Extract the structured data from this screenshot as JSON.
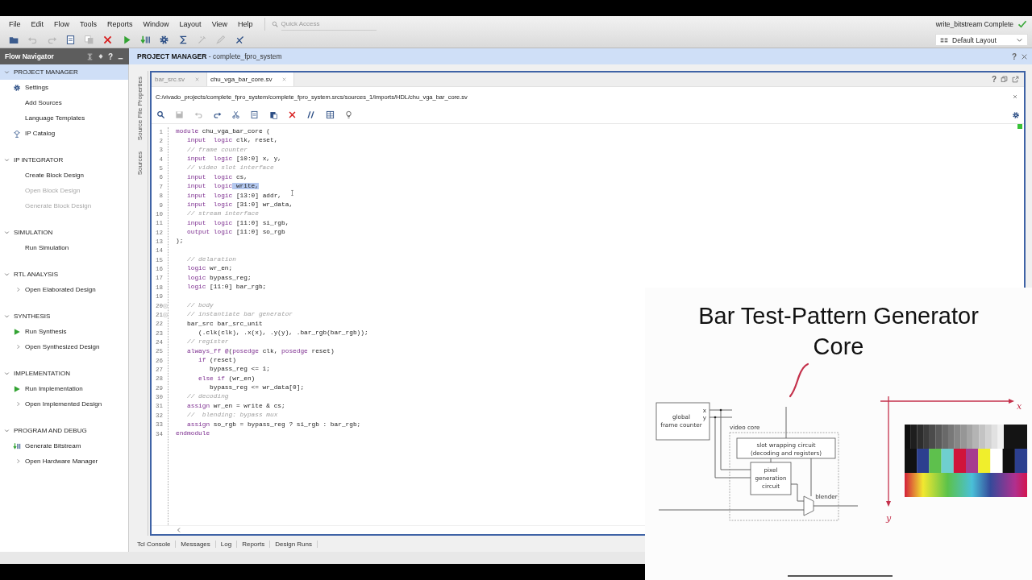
{
  "menu": [
    "File",
    "Edit",
    "Flow",
    "Tools",
    "Reports",
    "Window",
    "Layout",
    "View",
    "Help"
  ],
  "quick_access": {
    "placeholder": "Quick Access"
  },
  "toolbar_buttons": [
    {
      "disabled": false
    },
    {
      "disabled": true
    },
    {
      "disabled": true
    },
    {
      "disabled": false
    },
    {
      "disabled": true
    },
    {
      "disabled": false
    },
    {
      "disabled": false
    },
    {
      "disabled": false
    },
    {
      "disabled": false
    },
    {
      "disabled": false
    },
    {
      "disabled": true
    },
    {
      "disabled": true
    },
    {
      "disabled": false
    }
  ],
  "status": {
    "text": "write_bitstream Complete",
    "complete": true
  },
  "layout_select": {
    "value": "Default Layout"
  },
  "flow_navigator": {
    "title": "Flow Navigator",
    "help": "?",
    "sections": [
      {
        "title": "PROJECT MANAGER",
        "expanded": true,
        "selected": true,
        "items": [
          {
            "label": "Settings",
            "kind": "settings",
            "disabled": false
          },
          {
            "label": "Add Sources",
            "kind": "plain",
            "disabled": false
          },
          {
            "label": "Language Templates",
            "kind": "plain",
            "disabled": false
          },
          {
            "label": "IP Catalog",
            "kind": "catalog",
            "disabled": false
          }
        ]
      },
      {
        "title": "IP INTEGRATOR",
        "expanded": true,
        "selected": false,
        "items": [
          {
            "label": "Create Block Design",
            "kind": "plain",
            "disabled": false
          },
          {
            "label": "Open Block Design",
            "kind": "plain",
            "disabled": true
          },
          {
            "label": "Generate Block Design",
            "kind": "plain",
            "disabled": true
          }
        ]
      },
      {
        "title": "SIMULATION",
        "expanded": true,
        "selected": false,
        "items": [
          {
            "label": "Run Simulation",
            "kind": "plain",
            "disabled": false
          }
        ]
      },
      {
        "title": "RTL ANALYSIS",
        "expanded": true,
        "selected": false,
        "items": [
          {
            "label": "Open Elaborated Design",
            "kind": "expandable",
            "disabled": false
          }
        ]
      },
      {
        "title": "SYNTHESIS",
        "expanded": true,
        "selected": false,
        "items": [
          {
            "label": "Run Synthesis",
            "kind": "run",
            "disabled": false
          },
          {
            "label": "Open Synthesized Design",
            "kind": "expandable",
            "disabled": false
          }
        ]
      },
      {
        "title": "IMPLEMENTATION",
        "expanded": true,
        "selected": false,
        "items": [
          {
            "label": "Run Implementation",
            "kind": "run",
            "disabled": false
          },
          {
            "label": "Open Implemented Design",
            "kind": "expandable",
            "disabled": false
          }
        ]
      },
      {
        "title": "PROGRAM AND DEBUG",
        "expanded": true,
        "selected": false,
        "items": [
          {
            "label": "Generate Bitstream",
            "kind": "bitstream",
            "disabled": false
          },
          {
            "label": "Open Hardware Manager",
            "kind": "expandable",
            "disabled": false
          }
        ]
      }
    ]
  },
  "project_header": {
    "title": "**PROJECT MANAGER** - complete_fpro_system",
    "help": "?"
  },
  "side_tabs": [
    {
      "label": "Source File Properties"
    },
    {
      "label": "Sources"
    }
  ],
  "editor": {
    "help": "?",
    "tabs": [
      {
        "label": "bar_src.sv",
        "selected": false
      },
      {
        "label": "chu_vga_bar_core.sv",
        "selected": true
      }
    ],
    "path": "C:/vivado_projects/complete_fpro_system/complete_fpro_system.srcs/sources_1/imports/HDL/chu_vga_bar_core.sv",
    "toolbar_buttons": [
      {
        "disabled": false
      },
      {
        "disabled": true
      },
      {
        "disabled": true
      },
      {
        "disabled": false
      },
      {
        "disabled": false
      },
      {
        "disabled": false
      },
      {
        "disabled": false
      },
      {
        "disabled": false
      },
      {
        "disabled": false
      },
      {
        "disabled": false
      },
      {
        "disabled": false
      }
    ],
    "lines": [
      {
        "number": "1",
        "fold": false,
        "tokens": [
          {
            "kind": "keyword",
            "text": "module"
          },
          {
            "kind": "plain",
            "text": " chu_vga_bar_core ("
          }
        ]
      },
      {
        "number": "2",
        "fold": false,
        "tokens": [
          {
            "kind": "keyword",
            "text": "   input"
          },
          {
            "kind": "keyword",
            "text": "  logic"
          },
          {
            "kind": "plain",
            "text": " clk, reset,"
          }
        ]
      },
      {
        "number": "3",
        "fold": false,
        "tokens": [
          {
            "kind": "comment",
            "text": "   // frame counter"
          }
        ]
      },
      {
        "number": "4",
        "fold": false,
        "tokens": [
          {
            "kind": "keyword",
            "text": "   input"
          },
          {
            "kind": "keyword",
            "text": "  logic"
          },
          {
            "kind": "plain",
            "text": " [10:0] x, y,"
          }
        ]
      },
      {
        "number": "5",
        "fold": false,
        "tokens": [
          {
            "kind": "comment",
            "text": "   // video slot interface"
          }
        ]
      },
      {
        "number": "6",
        "fold": false,
        "tokens": [
          {
            "kind": "keyword",
            "text": "   input"
          },
          {
            "kind": "keyword",
            "text": "  logic"
          },
          {
            "kind": "plain",
            "text": " cs,"
          }
        ]
      },
      {
        "number": "7",
        "fold": false,
        "tokens": [
          {
            "kind": "keyword",
            "text": "   input"
          },
          {
            "kind": "keyword",
            "text": "  logic"
          },
          {
            "kind": "selected",
            "text": " write,"
          }
        ]
      },
      {
        "number": "8",
        "fold": false,
        "tokens": [
          {
            "kind": "keyword",
            "text": "   input"
          },
          {
            "kind": "keyword",
            "text": "  logic"
          },
          {
            "kind": "plain",
            "text": " [13:0] addr,"
          }
        ]
      },
      {
        "number": "9",
        "fold": false,
        "tokens": [
          {
            "kind": "keyword",
            "text": "   input"
          },
          {
            "kind": "keyword",
            "text": "  logic"
          },
          {
            "kind": "plain",
            "text": " [31:0] wr_data,"
          }
        ]
      },
      {
        "number": "10",
        "fold": false,
        "tokens": [
          {
            "kind": "comment",
            "text": "   // stream interface"
          }
        ]
      },
      {
        "number": "11",
        "fold": false,
        "tokens": [
          {
            "kind": "keyword",
            "text": "   input"
          },
          {
            "kind": "keyword",
            "text": "  logic"
          },
          {
            "kind": "plain",
            "text": " [11:0] si_rgb,"
          }
        ]
      },
      {
        "number": "12",
        "fold": false,
        "tokens": [
          {
            "kind": "keyword",
            "text": "   output"
          },
          {
            "kind": "keyword",
            "text": " logic"
          },
          {
            "kind": "plain",
            "text": " [11:0] so_rgb"
          }
        ]
      },
      {
        "number": "13",
        "fold": false,
        "tokens": [
          {
            "kind": "plain",
            "text": ");"
          }
        ]
      },
      {
        "number": "14",
        "fold": false
      },
      {
        "number": "15",
        "fold": false,
        "tokens": [
          {
            "kind": "comment",
            "text": "   // delaration"
          }
        ]
      },
      {
        "number": "16",
        "fold": false,
        "tokens": [
          {
            "kind": "keyword",
            "text": "   logic"
          },
          {
            "kind": "plain",
            "text": " wr_en;"
          }
        ]
      },
      {
        "number": "17",
        "fold": false,
        "tokens": [
          {
            "kind": "keyword",
            "text": "   logic"
          },
          {
            "kind": "plain",
            "text": " bypass_reg;"
          }
        ]
      },
      {
        "number": "18",
        "fold": false,
        "tokens": [
          {
            "kind": "keyword",
            "text": "   logic"
          },
          {
            "kind": "plain",
            "text": " [11:0] bar_rgb;"
          }
        ]
      },
      {
        "number": "19",
        "fold": false
      },
      {
        "number": "20",
        "fold": true,
        "tokens": [
          {
            "kind": "comment",
            "text": "   // body"
          }
        ]
      },
      {
        "number": "21",
        "fold": true,
        "tokens": [
          {
            "kind": "comment",
            "text": "   // instantiate bar generator"
          }
        ]
      },
      {
        "number": "22",
        "fold": false,
        "tokens": [
          {
            "kind": "plain",
            "text": "   bar_src bar_src_unit"
          }
        ]
      },
      {
        "number": "23",
        "fold": false,
        "tokens": [
          {
            "kind": "plain",
            "text": "      (.clk(clk), .x(x), .y(y), .bar_rgb(bar_rgb));"
          }
        ]
      },
      {
        "number": "24",
        "fold": false,
        "tokens": [
          {
            "kind": "comment",
            "text": "   // register"
          }
        ]
      },
      {
        "number": "25",
        "fold": false,
        "tokens": [
          {
            "kind": "keyword",
            "text": "   always_ff"
          },
          {
            "kind": "keyword",
            "text": " @"
          },
          {
            "kind": "plain",
            "text": "("
          },
          {
            "kind": "keyword",
            "text": "posedge"
          },
          {
            "kind": "plain",
            "text": " clk, "
          },
          {
            "kind": "keyword",
            "text": "posedge"
          },
          {
            "kind": "plain",
            "text": " reset)"
          }
        ]
      },
      {
        "number": "26",
        "fold": false,
        "tokens": [
          {
            "kind": "keyword",
            "text": "      if"
          },
          {
            "kind": "plain",
            "text": " (reset)"
          }
        ]
      },
      {
        "number": "27",
        "fold": false,
        "tokens": [
          {
            "kind": "plain",
            "text": "         bypass_reg <= 1;"
          }
        ]
      },
      {
        "number": "28",
        "fold": false,
        "tokens": [
          {
            "kind": "keyword",
            "text": "      else"
          },
          {
            "kind": "keyword",
            "text": " if"
          },
          {
            "kind": "plain",
            "text": " (wr_en)"
          }
        ]
      },
      {
        "number": "29",
        "fold": false,
        "tokens": [
          {
            "kind": "plain",
            "text": "         bypass_reg <= wr_data[0];"
          }
        ]
      },
      {
        "number": "30",
        "fold": false,
        "tokens": [
          {
            "kind": "comment",
            "text": "   // decoding"
          }
        ]
      },
      {
        "number": "31",
        "fold": false,
        "tokens": [
          {
            "kind": "keyword",
            "text": "   assign"
          },
          {
            "kind": "plain",
            "text": " wr_en = write & cs;"
          }
        ]
      },
      {
        "number": "32",
        "fold": false,
        "tokens": [
          {
            "kind": "comment",
            "text": "   //  blending: bypass mux"
          }
        ]
      },
      {
        "number": "33",
        "fold": false,
        "tokens": [
          {
            "kind": "keyword",
            "text": "   assign"
          },
          {
            "kind": "plain",
            "text": " so_rgb = bypass_reg ? si_rgb : bar_rgb;"
          }
        ]
      },
      {
        "number": "34",
        "fold": false,
        "tokens": [
          {
            "kind": "keyword",
            "text": "endmodule"
          }
        ]
      }
    ]
  },
  "bottom_tabs": [
    {
      "label": "Tcl Console"
    },
    {
      "label": "Messages"
    },
    {
      "label": "Log"
    },
    {
      "label": "Reports"
    },
    {
      "label": "Design Runs"
    }
  ],
  "slide": {
    "title": "Bar Test-Pattern Generator Core",
    "diagram": {
      "counter_lines": [
        "global",
        "frame counter"
      ],
      "port_labels": [
        "x",
        "y"
      ],
      "core_label": "video core",
      "wrapper_lines": [
        "slot wrapping circuit",
        "(decoding and registers)"
      ],
      "generator_lines": [
        "pixel",
        "generation",
        "circuit"
      ],
      "blender_label": "blender"
    },
    "axes": {
      "x_label": "x",
      "y_label": "y"
    }
  }
}
